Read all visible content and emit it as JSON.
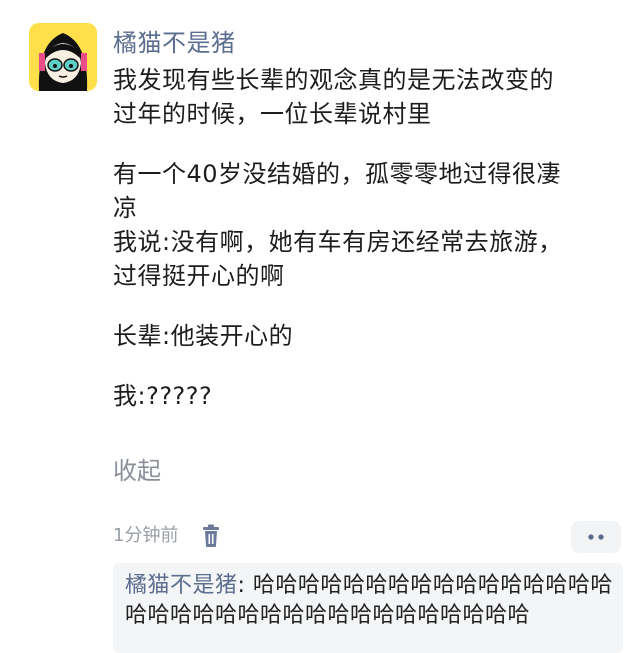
{
  "post": {
    "username": "橘猫不是猪",
    "lines": [
      "我发现有些长辈的观念真的是无法改变的",
      "过年的时候，一位长辈说村里",
      "",
      "有一个40岁没结婚的，孤零零地过得很凄",
      "凉",
      "我说:没有啊，她有车有房还经常去旅游，",
      "过得挺开心的啊",
      "",
      "长辈:他装开心的",
      "",
      "我:?????"
    ],
    "collapse_label": "收起",
    "time": "1分钟前",
    "icons": {
      "delete": "trash-icon",
      "more": "more-dots-icon"
    }
  },
  "reply": {
    "author": "橘猫不是猪",
    "separator": ": ",
    "text": "哈哈哈哈哈哈哈哈哈哈哈哈哈哈哈哈哈哈哈哈哈哈哈哈哈哈哈哈哈哈哈哈哈哈"
  },
  "colors": {
    "username": "#5c6e8f",
    "meta": "#9a9fa8",
    "reply_bg": "#f4f5f7",
    "avatar_bg": "#ffe04a"
  }
}
